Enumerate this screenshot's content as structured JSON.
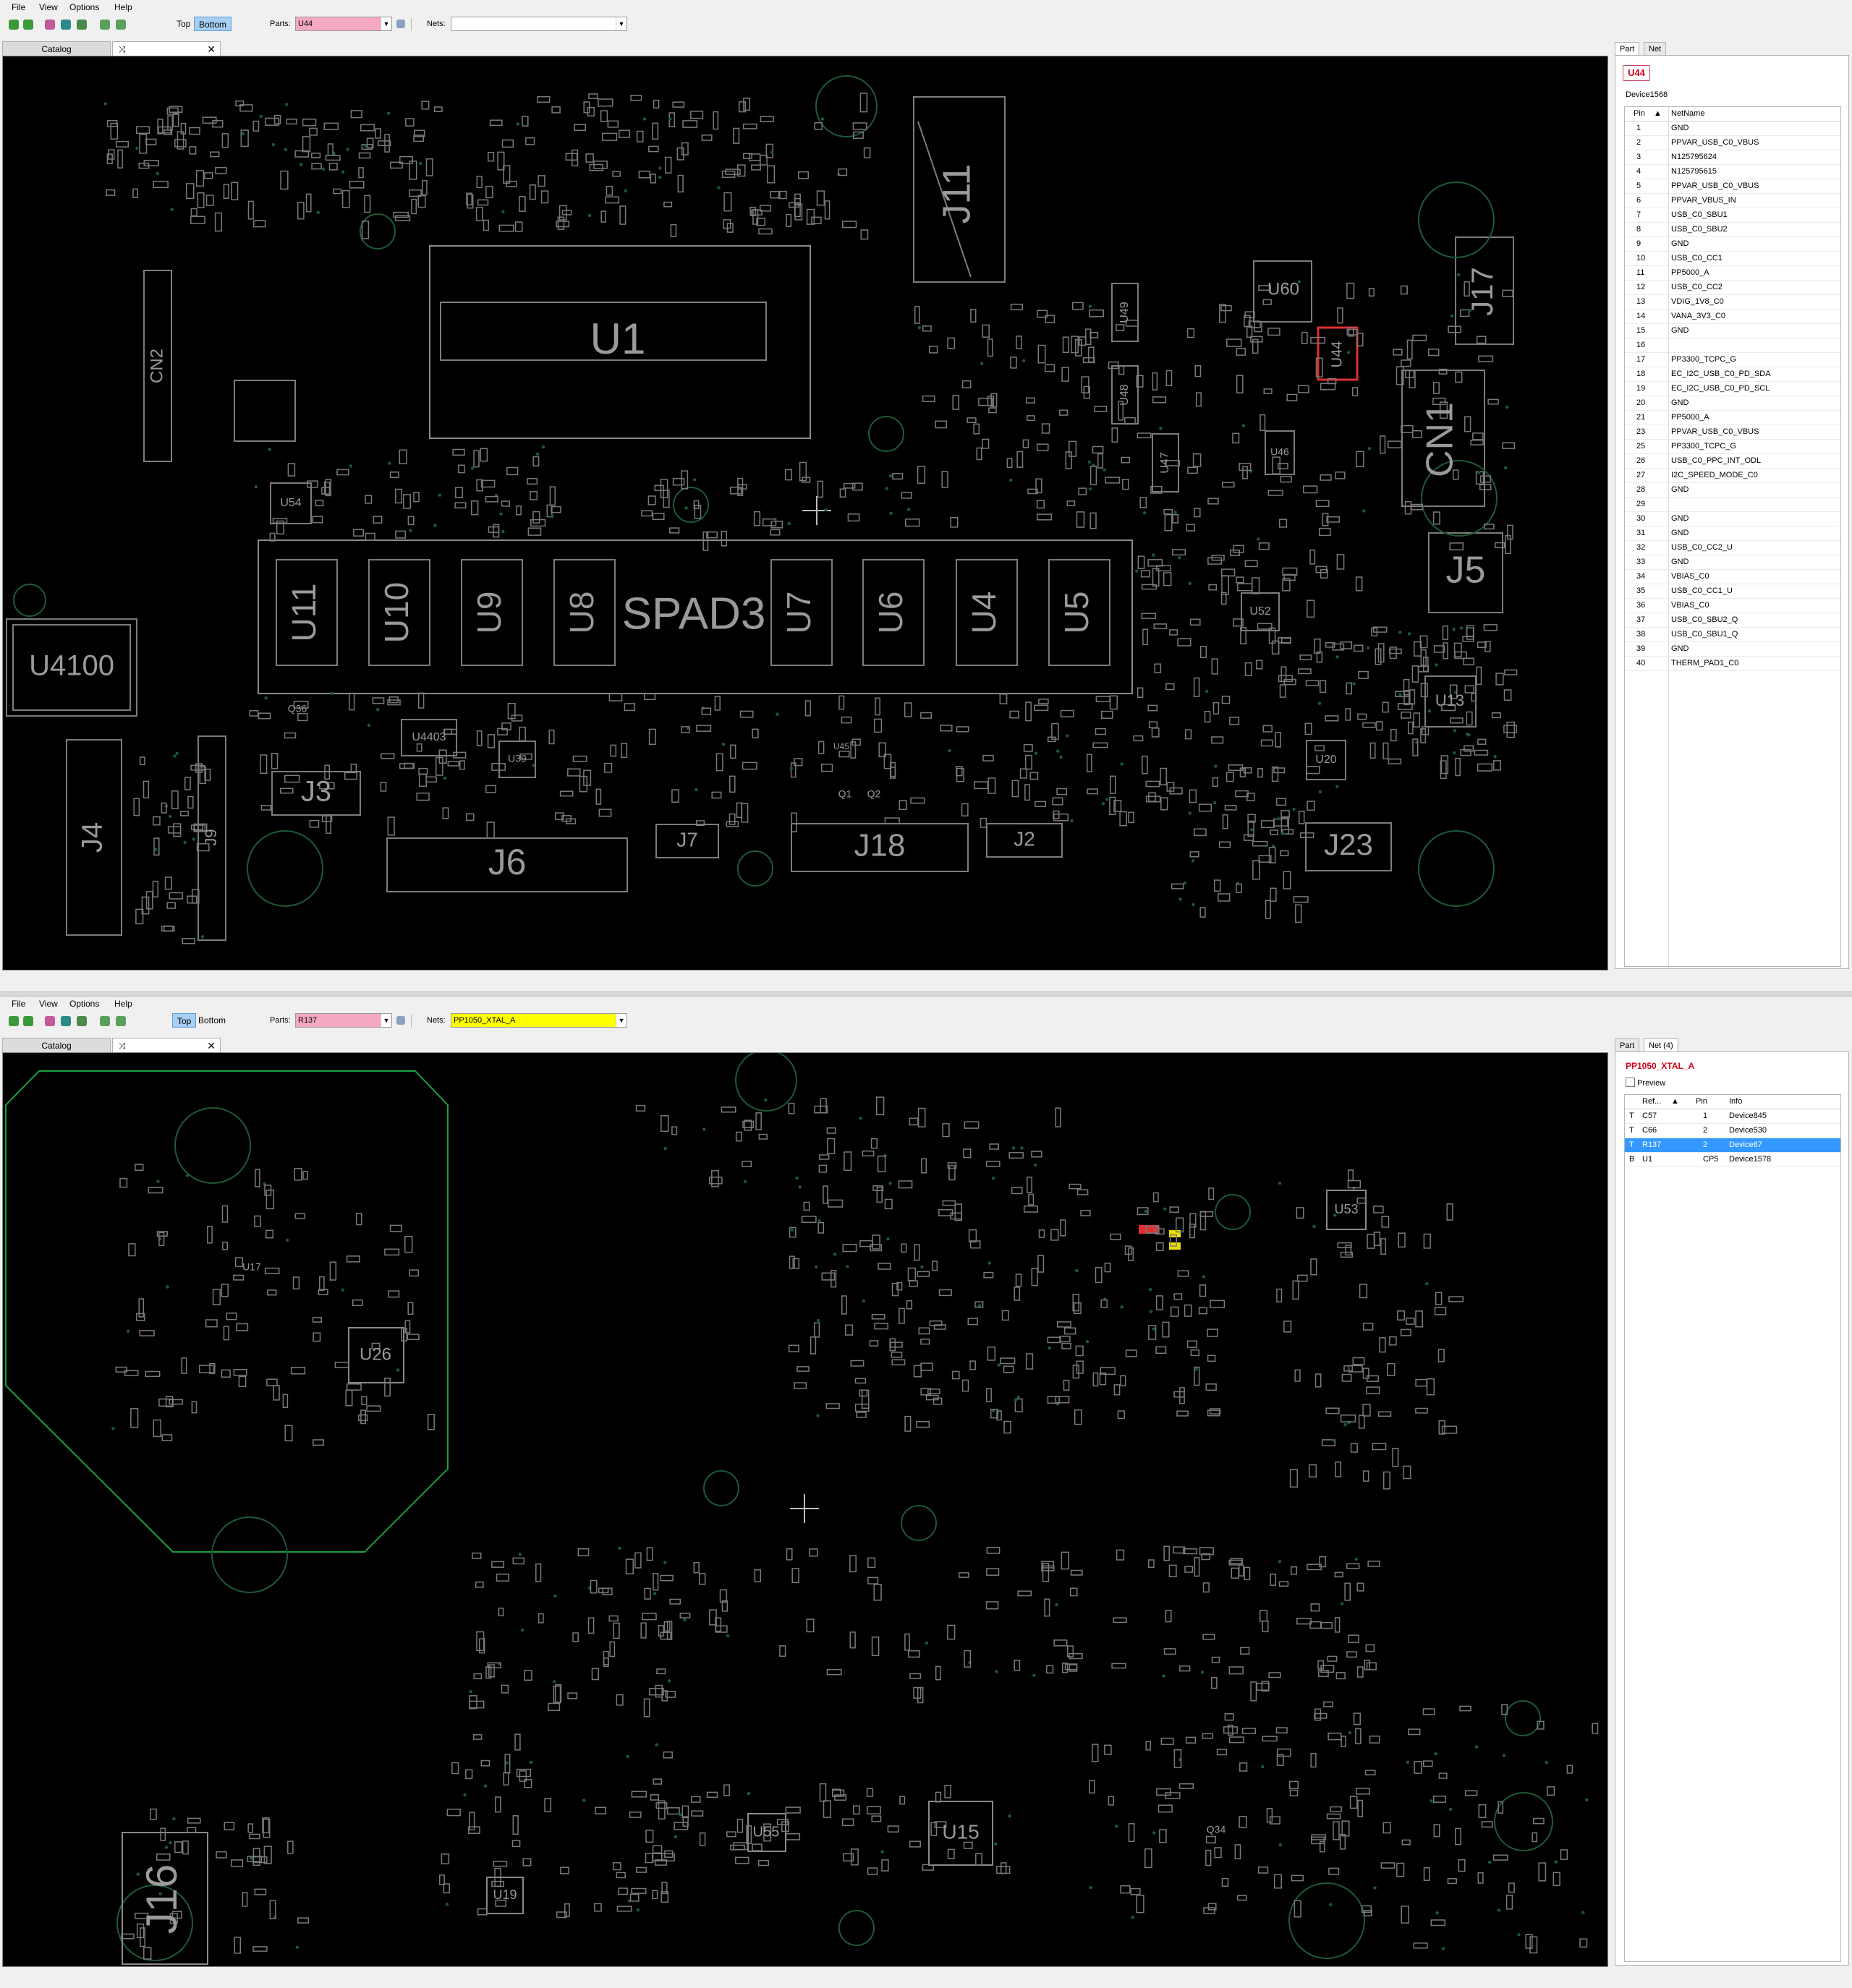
{
  "menu": [
    "File",
    "View",
    "Options",
    "Help"
  ],
  "colors": {
    "board_bg": "#000000",
    "silkscreen": "#8c8c8c",
    "outline": "#1aa040",
    "selection": "#3399ff",
    "nets_highlight": "#ffff00",
    "parts_highlight": "#f4a9c0",
    "selected_part": "#e03030"
  },
  "pane1": {
    "toolbar": {
      "top_label": "Top",
      "bottom_label": "Bottom",
      "active_side": "Bottom",
      "parts_label": "Parts:",
      "parts_value": "U44",
      "nets_label": "Nets:",
      "nets_value": ""
    },
    "tabs": {
      "catalog": "Catalog",
      "search_icon": "shuffle-icon"
    },
    "board_labels": [
      "U1",
      "SPAD3",
      "U4100",
      "J11",
      "J17",
      "CN1",
      "CN2",
      "U60",
      "U44",
      "J5",
      "U13",
      "J3",
      "J4",
      "J9",
      "J6",
      "J7",
      "J18",
      "J2",
      "J23",
      "U54",
      "U11",
      "U10",
      "U9",
      "U8",
      "U7",
      "U6",
      "U4",
      "U5",
      "U4403",
      "U52",
      "U20",
      "U49",
      "U48",
      "U47",
      "U46",
      "U39",
      "U45",
      "Q1",
      "Q2",
      "Q36"
    ],
    "side": {
      "tab_part": "Part",
      "tab_net": "Net",
      "part_name": "U44",
      "device": "Device1568",
      "headers": [
        "Pin",
        "NetName"
      ],
      "rows": [
        [
          "1",
          "GND"
        ],
        [
          "2",
          "PPVAR_USB_C0_VBUS"
        ],
        [
          "3",
          "N125795624"
        ],
        [
          "4",
          "N125795615"
        ],
        [
          "5",
          "PPVAR_USB_C0_VBUS"
        ],
        [
          "6",
          "PPVAR_VBUS_IN"
        ],
        [
          "7",
          "USB_C0_SBU1"
        ],
        [
          "8",
          "USB_C0_SBU2"
        ],
        [
          "9",
          "GND"
        ],
        [
          "10",
          "USB_C0_CC1"
        ],
        [
          "11",
          "PP5000_A"
        ],
        [
          "12",
          "USB_C0_CC2"
        ],
        [
          "13",
          "VDIG_1V8_C0"
        ],
        [
          "14",
          "VANA_3V3_C0"
        ],
        [
          "15",
          "GND"
        ],
        [
          "16",
          ""
        ],
        [
          "17",
          "PP3300_TCPC_G"
        ],
        [
          "18",
          "EC_I2C_USB_C0_PD_SDA"
        ],
        [
          "19",
          "EC_I2C_USB_C0_PD_SCL"
        ],
        [
          "20",
          "GND"
        ],
        [
          "21",
          "PP5000_A"
        ],
        [
          "23",
          "PPVAR_USB_C0_VBUS"
        ],
        [
          "25",
          "PP3300_TCPC_G"
        ],
        [
          "26",
          "USB_C0_PPC_INT_ODL"
        ],
        [
          "27",
          "I2C_SPEED_MODE_C0"
        ],
        [
          "28",
          "GND"
        ],
        [
          "29",
          ""
        ],
        [
          "30",
          "GND"
        ],
        [
          "31",
          "GND"
        ],
        [
          "32",
          "USB_C0_CC2_U"
        ],
        [
          "33",
          "GND"
        ],
        [
          "34",
          "VBIAS_C0"
        ],
        [
          "35",
          "USB_C0_CC1_U"
        ],
        [
          "36",
          "VBIAS_C0"
        ],
        [
          "37",
          "USB_C0_SBU2_Q"
        ],
        [
          "38",
          "USB_C0_SBU1_Q"
        ],
        [
          "39",
          "GND"
        ],
        [
          "40",
          "THERM_PAD1_C0"
        ]
      ]
    }
  },
  "pane2": {
    "toolbar": {
      "top_label": "Top",
      "bottom_label": "Bottom",
      "active_side": "Top",
      "parts_label": "Parts:",
      "parts_value": "R137",
      "nets_label": "Nets:",
      "nets_value": "PP1050_XTAL_A"
    },
    "tabs": {
      "catalog": "Catalog",
      "search_icon": "shuffle-icon"
    },
    "board_labels": [
      "J16",
      "U26",
      "U15",
      "U19",
      "U55",
      "U53",
      "U17",
      "Q34"
    ],
    "side": {
      "tab_part": "Part",
      "tab_net": "Net (4)",
      "net_name": "PP1050_XTAL_A",
      "preview_label": "Preview",
      "headers": [
        "Ref...",
        "Pin",
        "Info"
      ],
      "rows": [
        [
          "T",
          "C57",
          "1",
          "Device845"
        ],
        [
          "T",
          "C66",
          "2",
          "Device530"
        ],
        [
          "T",
          "R137",
          "2",
          "Device87"
        ],
        [
          "B",
          "U1",
          "CP5",
          "Device1578"
        ]
      ],
      "selected_index": 2
    }
  }
}
